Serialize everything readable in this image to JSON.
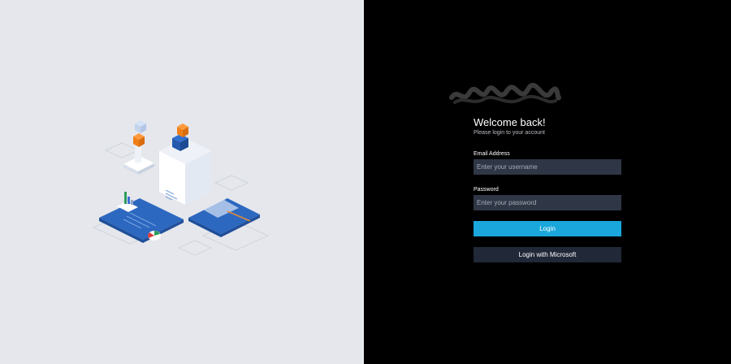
{
  "login": {
    "title": "Welcome back!",
    "subtitle": "Please login to your account",
    "email_label": "Email Address",
    "email_placeholder": "Enter your username",
    "email_value": "",
    "password_label": "Password",
    "password_placeholder": "Enter your password",
    "password_value": "",
    "login_button": "Login",
    "microsoft_button": "Login with Microsoft"
  },
  "colors": {
    "left_background": "#e5e7ec",
    "right_background": "#000000",
    "input_background": "#2f3645",
    "accent": "#1aa8dc",
    "secondary_button": "#212838"
  }
}
